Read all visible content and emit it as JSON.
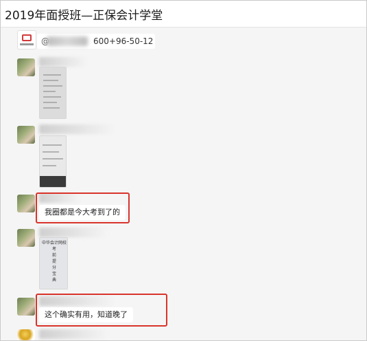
{
  "window": {
    "title": "2019年面授班—正保会计学堂"
  },
  "notice": {
    "prefix": "@",
    "number_text": "600+96-50-12"
  },
  "messages": {
    "msg3_text": "我圈都是今大考到了的",
    "msg5_text": "这个确实有用，知道晚了"
  },
  "doc_thumb": {
    "lines": [
      "中华会计网校",
      "考",
      "前",
      "提",
      "分",
      "宝",
      "典"
    ]
  },
  "colors": {
    "highlight_border": "#d9332b",
    "chat_bg": "#f5f5f5",
    "bubble_bg": "#ffffff"
  }
}
